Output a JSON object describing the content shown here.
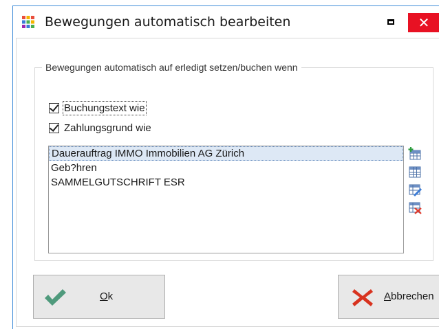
{
  "window": {
    "title": "Bewegungen automatisch bearbeiten",
    "close_glyph": "✕"
  },
  "group": {
    "label": "Bewegungen automatisch auf erledigt setzen/buchen wenn"
  },
  "checkboxes": [
    {
      "label": "Buchungstext wie",
      "checked": true
    },
    {
      "label": "Zahlungsgrund wie",
      "checked": true
    }
  ],
  "list": {
    "items": [
      "Dauerauftrag IMMO Immobilien AG Zürich",
      "Geb?hren",
      "SAMMELGUTSCHRIFT ESR"
    ],
    "selected_index": 0
  },
  "list_actions": [
    {
      "icon": "add-row-icon"
    },
    {
      "icon": "table-icon"
    },
    {
      "icon": "edit-row-icon"
    },
    {
      "icon": "delete-row-icon"
    }
  ],
  "buttons": {
    "ok": {
      "mnemonic": "O",
      "rest": "k",
      "icon": "checkmark-icon"
    },
    "cancel": {
      "mnemonic": "A",
      "rest": "bbrechen",
      "icon": "cross-icon"
    }
  },
  "colors": {
    "accent": "#3c8ad8",
    "close": "#e81123",
    "ok_check": "#4f9a7c",
    "cancel_cross": "#d8331f",
    "selection": "#dde8f5"
  }
}
